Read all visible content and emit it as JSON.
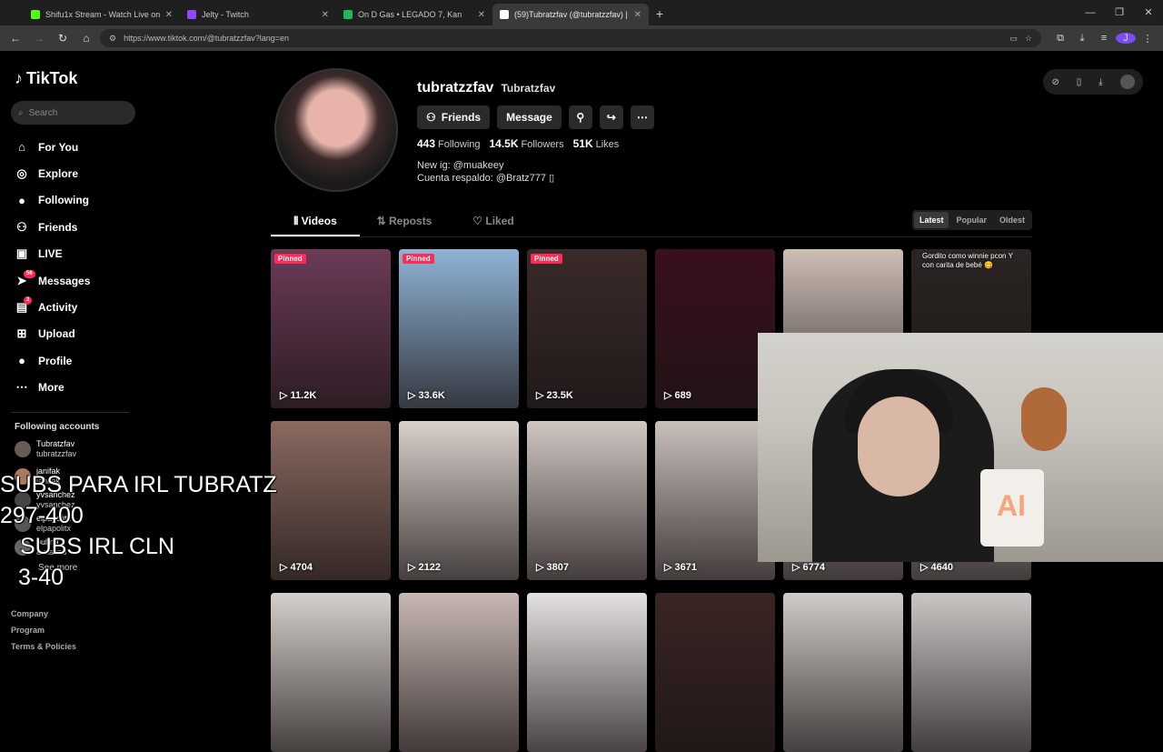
{
  "browser": {
    "tabs": [
      {
        "title": "Shifu1x Stream - Watch Live on",
        "favicon_color": "#53fc18",
        "active": false
      },
      {
        "title": "Jelty - Twitch",
        "favicon_color": "#9146ff",
        "active": false
      },
      {
        "title": "On D Gas • LEGADO 7, Kan",
        "favicon_color": "#1db954",
        "active": false
      },
      {
        "title": "(59)Tubratzfav (@tubratzzfav) |",
        "favicon_color": "#ffffff",
        "active": true
      }
    ],
    "new_tab": "+",
    "url": "https://www.tiktok.com/@tubratzzfav?lang=en",
    "profile_initial": "J"
  },
  "tiktok": {
    "logo": "TikTok",
    "search_placeholder": "Search",
    "nav": [
      {
        "label": "For You",
        "icon": "home-icon",
        "glyph": "⌂"
      },
      {
        "label": "Explore",
        "icon": "compass-icon",
        "glyph": "◎"
      },
      {
        "label": "Following",
        "icon": "following-avatar-icon",
        "glyph": "●"
      },
      {
        "label": "Friends",
        "icon": "friends-icon",
        "glyph": "⚇"
      },
      {
        "label": "LIVE",
        "icon": "live-icon",
        "glyph": "▣"
      },
      {
        "label": "Messages",
        "icon": "messages-icon",
        "glyph": "➤",
        "badge": "56"
      },
      {
        "label": "Activity",
        "icon": "activity-icon",
        "glyph": "▤",
        "badge": "3"
      },
      {
        "label": "Upload",
        "icon": "upload-icon",
        "glyph": "⊞"
      },
      {
        "label": "Profile",
        "icon": "profile-avatar-icon",
        "glyph": "●"
      },
      {
        "label": "More",
        "icon": "more-icon",
        "glyph": "⋯"
      }
    ],
    "following_title": "Following accounts",
    "following_accounts": [
      {
        "name": "Tubratzfav",
        "handle": "tubratzzfav"
      },
      {
        "name": "janifak",
        "handle": "janifak"
      },
      {
        "name": "yvsanchez",
        "handle": "yvsanchez"
      },
      {
        "name": "elpapolitx",
        "handle": "elpapolitx"
      },
      {
        "name": "bulma",
        "handle": "a.zlava8"
      }
    ],
    "see_more": "See more",
    "footer": [
      "Company",
      "Program",
      "Terms & Policies"
    ]
  },
  "overlay": [
    "SUBS PARA IRL TUBRATZ",
    "297-400",
    "SUBS IRL CLN",
    "3-40"
  ],
  "profile": {
    "handle": "tubratzzfav",
    "name": "Tubratzfav",
    "friends_label": "Friends",
    "message_label": "Message",
    "following_count": "443",
    "following_label": "Following",
    "followers_count": "14.5K",
    "followers_label": "Followers",
    "likes_count": "51K",
    "likes_label": "Likes",
    "bio_line1": "New ig: @muakeey",
    "bio_line2": "Cuenta respaldo: @Bratz777 ▯",
    "tabs": [
      "Videos",
      "Reposts",
      "Liked"
    ],
    "sort": [
      "Latest",
      "Popular",
      "Oldest"
    ]
  },
  "videos": [
    {
      "views": "11.2K",
      "pinned": "Pinned",
      "bg": "#6b3a58"
    },
    {
      "views": "33.6K",
      "pinned": "Pinned",
      "bg": "#8fb3d6"
    },
    {
      "views": "23.5K",
      "pinned": "Pinned",
      "bg": "#3a2a2a"
    },
    {
      "views": "689",
      "bg": "#3a0f1e"
    },
    {
      "views": "",
      "bg": "#cdbdb5"
    },
    {
      "views": "",
      "caption": "Gordito como winnie pcon Y con carita de bebé 😋",
      "bg": "#2a2422"
    },
    {
      "views": "4704",
      "bg": "#8a6a60"
    },
    {
      "views": "2122",
      "bg": "#d7d0cb"
    },
    {
      "views": "3807",
      "bg": "#cfc6c2"
    },
    {
      "views": "3671",
      "bg": "#c9c0bc"
    },
    {
      "views": "6774",
      "bg": "#bfb8b4"
    },
    {
      "views": "4640",
      "bg": "#c4beba"
    },
    {
      "views": "",
      "bg": "#d6d0cc"
    },
    {
      "views": "",
      "bg": "#c8b8b4"
    },
    {
      "views": "",
      "bg": "#e4e2e0"
    },
    {
      "views": "",
      "bg": "#3a2524"
    },
    {
      "views": "",
      "bg": "#d0cac8"
    },
    {
      "views": "",
      "bg": "#cbc6c4"
    }
  ],
  "webcam": {
    "mug_text": "AI"
  }
}
